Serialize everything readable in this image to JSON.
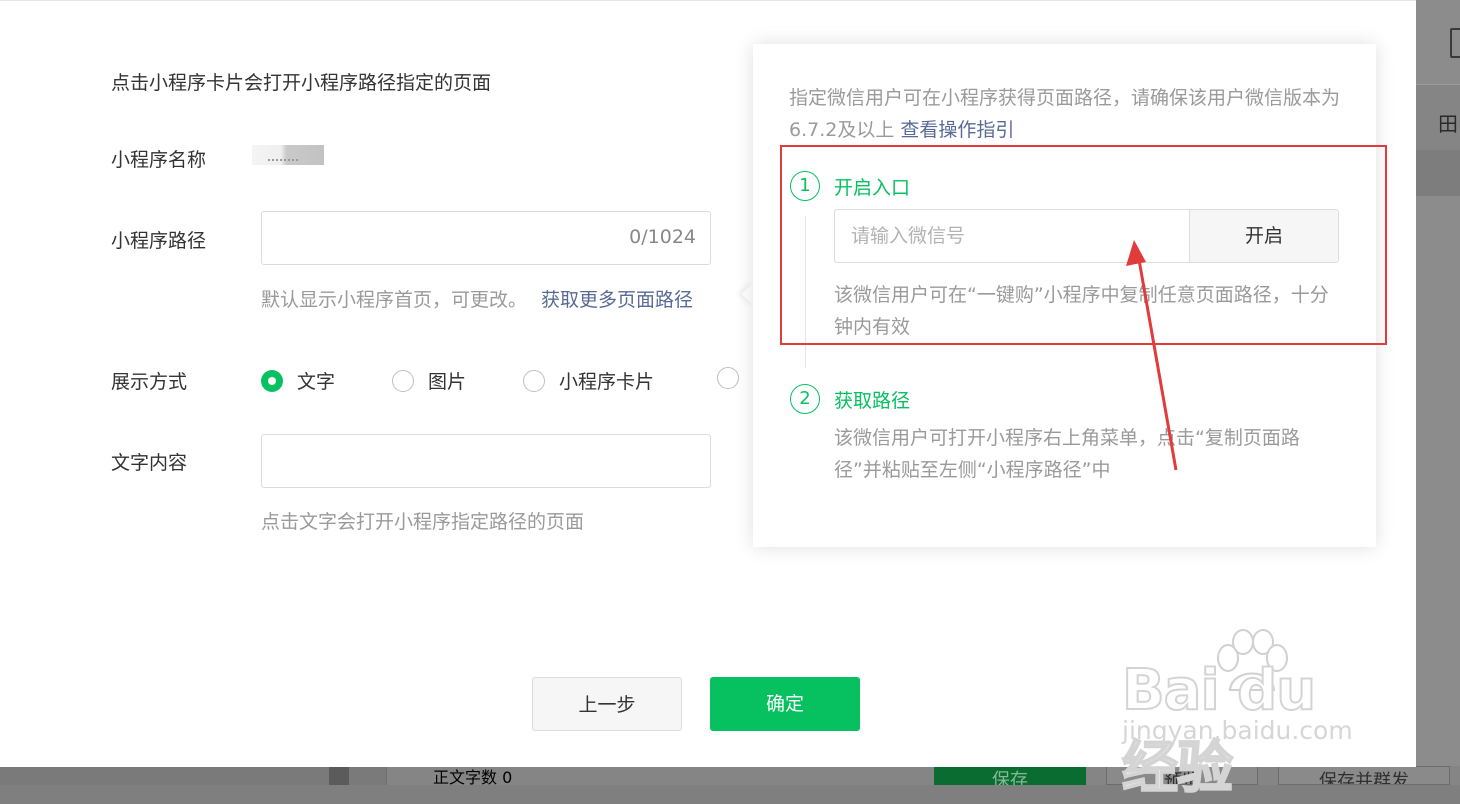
{
  "dialog": {
    "intro": "点击小程序卡片会打开小程序路径指定的页面",
    "name_label": "小程序名称",
    "path_label": "小程序路径",
    "path_counter": "0/1024",
    "path_hint": "默认显示小程序首页，可更改。",
    "path_more_link": "获取更多页面路径",
    "display_label": "展示方式",
    "display_options": [
      {
        "label": "文字",
        "checked": true
      },
      {
        "label": "图片",
        "checked": false
      },
      {
        "label": "小程序卡片",
        "checked": false
      },
      {
        "label": "",
        "checked": false
      }
    ],
    "text_label": "文字内容",
    "text_hint": "点击文字会打开小程序指定路径的页面",
    "prev_button": "上一步",
    "ok_button": "确定"
  },
  "popover": {
    "description": "指定微信用户可在小程序获得页面路径，请确保该用户微信版本为6.7.2及以上",
    "guide_link": "查看操作指引",
    "step1": {
      "number": "1",
      "title": "开启入口",
      "input_placeholder": "请输入微信号",
      "open_button": "开启",
      "text": "该微信用户可在“一键购”小程序中复制任意页面路径，十分钟内有效"
    },
    "step2": {
      "number": "2",
      "title": "获取路径",
      "text": "该微信用户可打开小程序右上角菜单，点击“复制页面路径”并粘贴至左侧“小程序路径”中"
    }
  },
  "background": {
    "word_count": "正文字数  0",
    "save_button": "保存",
    "preview_button": "预览",
    "save_send_button": "保存并群发"
  },
  "watermark": {
    "logo": "Bai du 经验",
    "url": "jingyan.baidu.com"
  },
  "colors": {
    "accent": "#07c160",
    "link": "#576b95",
    "annotation": "#e23b3b"
  }
}
